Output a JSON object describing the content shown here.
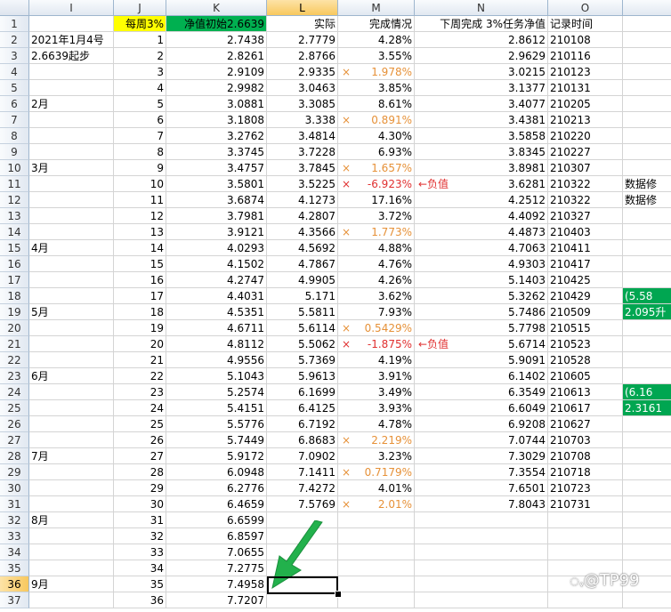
{
  "columns": [
    "I",
    "J",
    "K",
    "L",
    "M",
    "N",
    "O"
  ],
  "selected_column": "L",
  "selected_row": "36",
  "rows": [
    {
      "n": "1",
      "I": "",
      "J": "每周3%",
      "K": "净值初始2.6639",
      "L": "实际",
      "M": "完成情况",
      "N": "下周完成  3%任务净值",
      "O": "记录时间",
      "P": ""
    },
    {
      "n": "2",
      "I": "2021年1月4号",
      "J": "1",
      "K": "2.7438",
      "L": "2.7779",
      "M": "4.28%",
      "N": "2.8612",
      "O": "210108",
      "P": ""
    },
    {
      "n": "3",
      "I": "2.6639起步",
      "J": "2",
      "K": "2.8261",
      "L": "2.8766",
      "M": "3.55%",
      "N": "2.9629",
      "O": "210116",
      "P": ""
    },
    {
      "n": "4",
      "I": "",
      "J": "3",
      "K": "2.9109",
      "L": "2.9335",
      "M": "1.978%",
      "N": "3.0215",
      "O": "210123",
      "P": ""
    },
    {
      "n": "5",
      "I": "",
      "J": "4",
      "K": "2.9982",
      "L": "3.0463",
      "M": "3.85%",
      "N": "3.1377",
      "O": "210131",
      "P": ""
    },
    {
      "n": "6",
      "I": "2月",
      "J": "5",
      "K": "3.0881",
      "L": "3.3085",
      "M": "8.61%",
      "N": "3.4077",
      "O": "210205",
      "P": ""
    },
    {
      "n": "7",
      "I": "",
      "J": "6",
      "K": "3.1808",
      "L": "3.338",
      "M": "0.891%",
      "N": "3.4381",
      "O": "210213",
      "P": ""
    },
    {
      "n": "8",
      "I": "",
      "J": "7",
      "K": "3.2762",
      "L": "3.4814",
      "M": "4.30%",
      "N": "3.5858",
      "O": "210220",
      "P": ""
    },
    {
      "n": "9",
      "I": "",
      "J": "8",
      "K": "3.3745",
      "L": "3.7228",
      "M": "6.93%",
      "N": "3.8345",
      "O": "210227",
      "P": ""
    },
    {
      "n": "10",
      "I": "3月",
      "J": "9",
      "K": "3.4757",
      "L": "3.7845",
      "M": "1.657%",
      "N": "3.8981",
      "O": "210307",
      "P": ""
    },
    {
      "n": "11",
      "I": "",
      "J": "10",
      "K": "3.5801",
      "L": "3.5225",
      "M": "-6.923%",
      "N": "3.6281",
      "O": "210322",
      "P": "数据修"
    },
    {
      "n": "12",
      "I": "",
      "J": "11",
      "K": "3.6874",
      "L": "4.1273",
      "M": "17.16%",
      "N": "4.2512",
      "O": "210322",
      "P": "数据修"
    },
    {
      "n": "13",
      "I": "",
      "J": "12",
      "K": "3.7981",
      "L": "4.2807",
      "M": "3.72%",
      "N": "4.4092",
      "O": "210327",
      "P": ""
    },
    {
      "n": "14",
      "I": "",
      "J": "13",
      "K": "3.9121",
      "L": "4.3566",
      "M": "1.773%",
      "N": "4.4873",
      "O": "210403",
      "P": ""
    },
    {
      "n": "15",
      "I": "4月",
      "J": "14",
      "K": "4.0293",
      "L": "4.5692",
      "M": "4.88%",
      "N": "4.7063",
      "O": "210411",
      "P": ""
    },
    {
      "n": "16",
      "I": "",
      "J": "15",
      "K": "4.1502",
      "L": "4.7867",
      "M": "4.76%",
      "N": "4.9303",
      "O": "210417",
      "P": ""
    },
    {
      "n": "17",
      "I": "",
      "J": "16",
      "K": "4.2747",
      "L": "4.9905",
      "M": "4.26%",
      "N": "5.1403",
      "O": "210425",
      "P": ""
    },
    {
      "n": "18",
      "I": "",
      "J": "17",
      "K": "4.4031",
      "L": "5.171",
      "M": "3.62%",
      "N": "5.3262",
      "O": "210429",
      "P": "(5.58"
    },
    {
      "n": "19",
      "I": "5月",
      "J": "18",
      "K": "4.5351",
      "L": "5.5811",
      "M": "7.93%",
      "N": "5.7486",
      "O": "210509",
      "P": "2.095升"
    },
    {
      "n": "20",
      "I": "",
      "J": "19",
      "K": "4.6711",
      "L": "5.6114",
      "M": "0.5429%",
      "N": "5.7798",
      "O": "210515",
      "P": ""
    },
    {
      "n": "21",
      "I": "",
      "J": "20",
      "K": "4.8112",
      "L": "5.5062",
      "M": "-1.875%",
      "N": "5.6714",
      "O": "210523",
      "P": ""
    },
    {
      "n": "22",
      "I": "",
      "J": "21",
      "K": "4.9556",
      "L": "5.7369",
      "M": "4.19%",
      "N": "5.9091",
      "O": "210528",
      "P": ""
    },
    {
      "n": "23",
      "I": "6月",
      "J": "22",
      "K": "5.1043",
      "L": "5.9613",
      "M": "3.91%",
      "N": "6.1402",
      "O": "210605",
      "P": ""
    },
    {
      "n": "24",
      "I": "",
      "J": "23",
      "K": "5.2574",
      "L": "6.1699",
      "M": "3.49%",
      "N": "6.3549",
      "O": "210613",
      "P": "(6.16"
    },
    {
      "n": "25",
      "I": "",
      "J": "24",
      "K": "5.4151",
      "L": "6.4125",
      "M": "3.93%",
      "N": "6.6049",
      "O": "210617",
      "P": "2.3161"
    },
    {
      "n": "26",
      "I": "",
      "J": "25",
      "K": "5.5776",
      "L": "6.7192",
      "M": "4.78%",
      "N": "6.9208",
      "O": "210627",
      "P": ""
    },
    {
      "n": "27",
      "I": "",
      "J": "26",
      "K": "5.7449",
      "L": "6.8683",
      "M": "2.219%",
      "N": "7.0744",
      "O": "210703",
      "P": ""
    },
    {
      "n": "28",
      "I": "7月",
      "J": "27",
      "K": "5.9172",
      "L": "7.0902",
      "M": "3.23%",
      "N": "7.3029",
      "O": "210708",
      "P": ""
    },
    {
      "n": "29",
      "I": "",
      "J": "28",
      "K": "6.0948",
      "L": "7.1411",
      "M": "0.7179%",
      "N": "7.3554",
      "O": "210718",
      "P": ""
    },
    {
      "n": "30",
      "I": "",
      "J": "29",
      "K": "6.2776",
      "L": "7.4272",
      "M": "4.01%",
      "N": "7.6501",
      "O": "210723",
      "P": ""
    },
    {
      "n": "31",
      "I": "",
      "J": "30",
      "K": "6.4659",
      "L": "7.5769",
      "M": "2.01%",
      "N": "7.8043",
      "O": "210731",
      "P": ""
    },
    {
      "n": "32",
      "I": "8月",
      "J": "31",
      "K": "6.6599",
      "L": "",
      "M": "",
      "N": "",
      "O": "",
      "P": ""
    },
    {
      "n": "33",
      "I": "",
      "J": "32",
      "K": "6.8597",
      "L": "",
      "M": "",
      "N": "",
      "O": "",
      "P": ""
    },
    {
      "n": "34",
      "I": "",
      "J": "33",
      "K": "7.0655",
      "L": "",
      "M": "",
      "N": "",
      "O": "",
      "P": ""
    },
    {
      "n": "35",
      "I": "",
      "J": "34",
      "K": "7.2775",
      "L": "",
      "M": "",
      "N": "",
      "O": "",
      "P": ""
    },
    {
      "n": "36",
      "I": "9月",
      "J": "35",
      "K": "7.4958",
      "L": "",
      "M": "",
      "N": "",
      "O": "",
      "P": ""
    },
    {
      "n": "37",
      "I": "",
      "J": "36",
      "K": "7.7207",
      "L": "",
      "M": "",
      "N": "",
      "O": "",
      "P": ""
    }
  ],
  "orange_rows": [
    "4",
    "7",
    "10",
    "14",
    "20",
    "27",
    "29",
    "31"
  ],
  "red_rows": [
    "11",
    "21"
  ],
  "green_rows": [
    "18",
    "19",
    "24",
    "25"
  ],
  "cross_mark": "×",
  "negative_note": "←负值",
  "watermark": "@TP99",
  "colors": {
    "yellow": "#ffff00",
    "green": "#00b050",
    "orange": "#e69138",
    "red": "#e03030",
    "arrow": "#22b14c"
  }
}
